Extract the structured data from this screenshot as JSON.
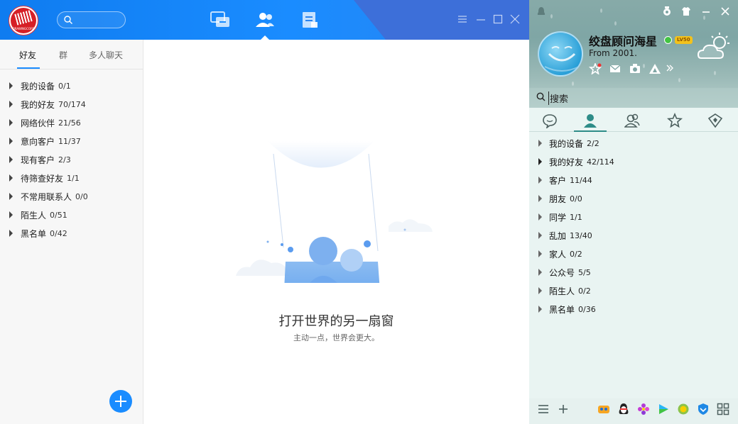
{
  "left_window": {
    "avatar_text": "DRAWINGCORP",
    "search_placeholder": "",
    "nav": [
      {
        "name": "chat",
        "icon": "chat-bubbles-icon"
      },
      {
        "name": "contacts",
        "icon": "contacts-icon"
      },
      {
        "name": "files",
        "icon": "document-icon"
      }
    ],
    "window_controls": [
      "menu-icon",
      "minimize-icon",
      "maximize-icon",
      "close-icon"
    ],
    "tabs": [
      {
        "label": "好友"
      },
      {
        "label": "群"
      },
      {
        "label": "多人聊天"
      }
    ],
    "groups": [
      {
        "name": "我的设备",
        "count": "0/1"
      },
      {
        "name": "我的好友",
        "count": "70/174"
      },
      {
        "name": "网络伙伴",
        "count": "21/56"
      },
      {
        "name": "意向客户",
        "count": "11/37"
      },
      {
        "name": "现有客户",
        "count": "2/3"
      },
      {
        "name": "待筛查好友",
        "count": "1/1"
      },
      {
        "name": "不常用联系人",
        "count": "0/0"
      },
      {
        "name": "陌生人",
        "count": "0/51"
      },
      {
        "name": "黑名单",
        "count": "0/42"
      }
    ],
    "empty_state": {
      "title": "打开世界的另一扇窗",
      "subtitle": "主动一点，世界会更大。"
    },
    "accent_color": "#1a8cff"
  },
  "right_window": {
    "user": {
      "nickname": "绞盘顾问海星",
      "level_badge": "LV50",
      "signature": "From 2001."
    },
    "search_label": "搜索",
    "tab_icons": [
      "chat-bubble-icon",
      "contact-icon",
      "group-icon",
      "star-icon",
      "diamond-icon"
    ],
    "groups": [
      {
        "name": "我的设备",
        "count": "2/2"
      },
      {
        "name": "我的好友",
        "count": "42/114"
      },
      {
        "name": "客户",
        "count": "11/44"
      },
      {
        "name": "朋友",
        "count": "0/0"
      },
      {
        "name": "同学",
        "count": "1/1"
      },
      {
        "name": "乱加",
        "count": "13/40"
      },
      {
        "name": "家人",
        "count": "0/2"
      },
      {
        "name": "公众号",
        "count": "5/5"
      },
      {
        "name": "陌生人",
        "count": "0/2"
      },
      {
        "name": "黑名单",
        "count": "0/36"
      }
    ],
    "bottom_icons": [
      "menu-icon",
      "add-icon",
      "game-icon",
      "penguin-icon",
      "flower-icon",
      "video-play-icon",
      "coin-icon",
      "shield-icon",
      "apps-grid-icon"
    ],
    "accent_color": "#2e8c88"
  }
}
